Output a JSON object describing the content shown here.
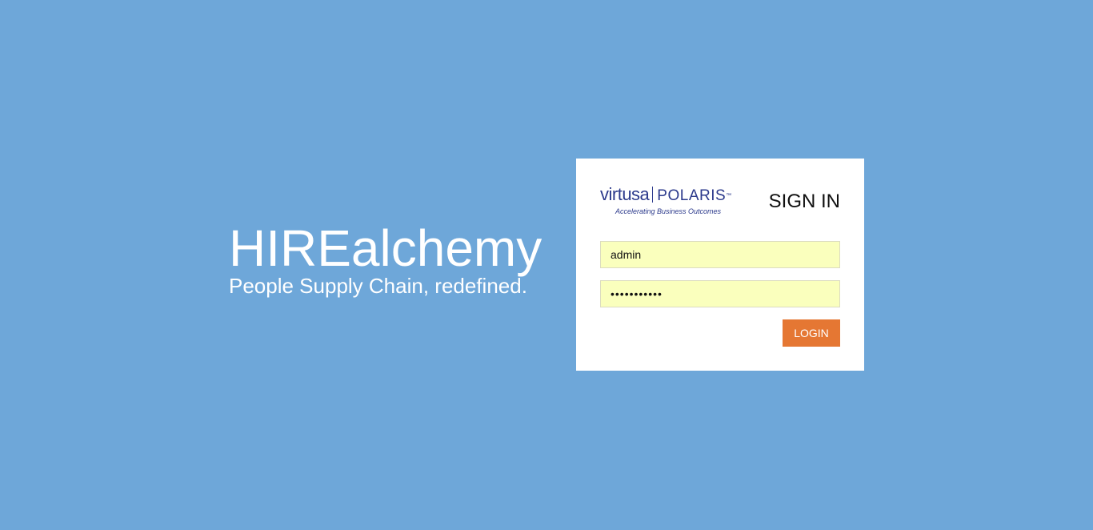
{
  "brand": {
    "title": "HIREalchemy",
    "tagline": "People Supply Chain, redefined."
  },
  "logo": {
    "name_left": "virtusa",
    "name_right": "POLARIS",
    "trademark": "™",
    "slogan": "Accelerating Business Outcomes"
  },
  "login": {
    "heading": "SIGN IN",
    "username_value": "admin",
    "password_value": "•••••••••••",
    "button_label": "LOGIN"
  },
  "colors": {
    "background": "#6ea7d9",
    "card": "#ffffff",
    "field_autofill": "#faffbd",
    "button": "#e57733",
    "logo": "#2c3a8c"
  }
}
